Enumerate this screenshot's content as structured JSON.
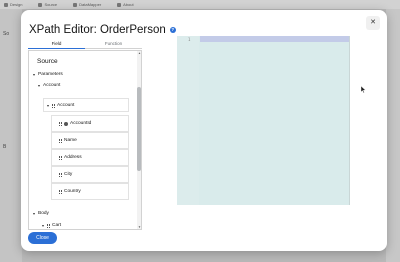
{
  "background": {
    "tabs": [
      "Design",
      "Source",
      "DataMapper",
      "About"
    ],
    "side_label": "So",
    "side_label_b": "B"
  },
  "modal": {
    "title": "XPath Editor: OrderPerson",
    "close_symbol": "✕",
    "tabs": [
      "Field",
      "Function"
    ],
    "active_tab": "Field",
    "tree": {
      "heading": "Source",
      "nodes": [
        {
          "label": "Parameters",
          "level": 0,
          "expanded": true
        },
        {
          "label": "Account",
          "level": 1,
          "expanded": true
        },
        {
          "label": "Account",
          "level": 2,
          "expanded": true
        },
        {
          "label": "AccountId",
          "level": 3
        },
        {
          "label": "Name",
          "level": 3
        },
        {
          "label": "Address",
          "level": 3
        },
        {
          "label": "City",
          "level": 3
        },
        {
          "label": "Country",
          "level": 3
        },
        {
          "label": "Body",
          "level": 0,
          "expanded": true
        },
        {
          "label": "Cart",
          "level": 1,
          "expanded": true
        }
      ]
    },
    "editor": {
      "line_number": "1",
      "content": ""
    },
    "close_button": "Close"
  },
  "colors": {
    "accent": "#2b6fd6",
    "editor_bg": "#d9ebeb",
    "selection": "#c3cbe8"
  },
  "icons": [
    "help-icon",
    "close-icon",
    "chevron-down-icon",
    "grip-icon",
    "key-icon"
  ]
}
